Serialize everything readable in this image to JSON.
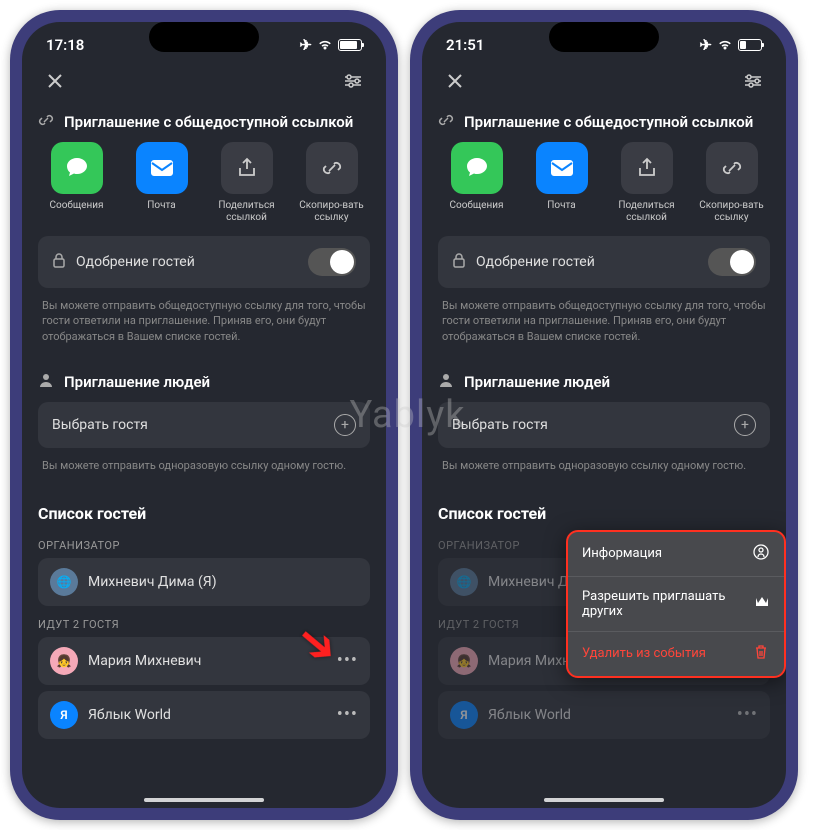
{
  "watermark": "Yablyk",
  "left": {
    "status_time": "17:18",
    "battery": "83",
    "sections": {
      "invite_link_title": "Приглашение с общедоступной ссылкой",
      "share": {
        "messages": "Сообщения",
        "mail": "Почта",
        "share_link": "Поделиться ссылкой",
        "copy_link": "Скопиро-вать ссылку"
      },
      "approval_label": "Одобрение гостей",
      "approval_help": "Вы можете отправить общедоступную ссылку для того, чтобы гости ответили на приглашение. Приняв его, они будут отображаться в Вашем списке гостей.",
      "invite_people_title": "Приглашение людей",
      "choose_guest": "Выбрать гостя",
      "choose_help": "Вы можете отправить одноразовую ссылку одному гостю.",
      "guest_list": "Список гостей",
      "organizer_label": "ОРГАНИЗАТОР",
      "organizer_name": "Михневич Дима (Я)",
      "guests_going_label": "ИДУТ 2 ГОСТЯ",
      "guest1": "Мария Михневич",
      "guest2": "Яблык World",
      "guest2_letter": "Я"
    }
  },
  "right": {
    "status_time": "21:51",
    "battery": "28",
    "context_menu": {
      "info": "Информация",
      "allow_invite": "Разрешить приглашать других",
      "remove": "Удалить из события"
    }
  }
}
